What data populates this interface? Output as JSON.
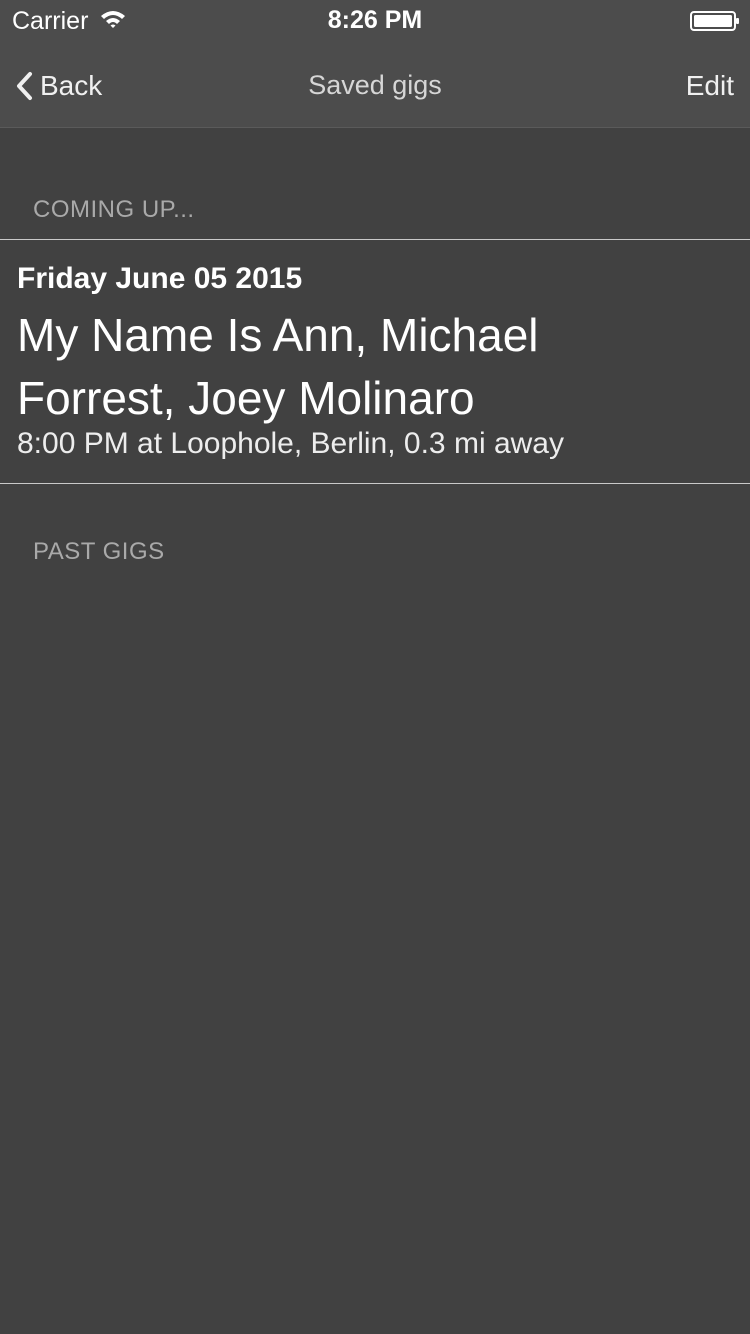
{
  "status_bar": {
    "carrier": "Carrier",
    "time": "8:26 PM",
    "wifi_icon": "wifi-icon",
    "battery_icon": "battery-icon"
  },
  "nav": {
    "back_label": "Back",
    "back_icon": "chevron-left-icon",
    "title": "Saved gigs",
    "edit_label": "Edit"
  },
  "sections": {
    "upcoming_header": "COMING UP...",
    "past_header": "PAST GIGS"
  },
  "upcoming_gigs": [
    {
      "date": "Friday June 05 2015",
      "artists": "My Name Is Ann, Michael Forrest, Joey Molinaro",
      "details": "8:00 PM at Loophole, Berlin, 0.3 mi away"
    }
  ],
  "colors": {
    "background": "#414141",
    "header_background": "#4c4c4c",
    "section_header_text": "#a9a9a9",
    "separator": "#c9c9c9"
  }
}
